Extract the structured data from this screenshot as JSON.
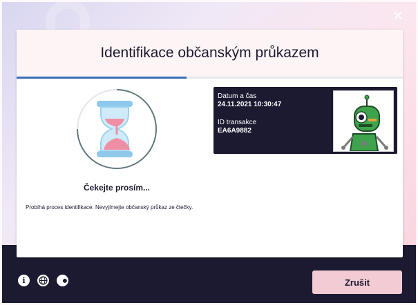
{
  "dialog": {
    "title": "Identifikace občanským průkazem",
    "progress_fraction": 0.44
  },
  "status": {
    "waiting_text": "Čekejte prosím...",
    "info_text": "Probíhá proces identifikace. Nevyjímejte občanský průkaz ze čtečky."
  },
  "transaction": {
    "datetime_label": "Datum a čas",
    "datetime_value": "24.11.2021 10:30:47",
    "id_label": "ID transakce",
    "id_value": "EA6A9882"
  },
  "footer": {
    "icons": [
      "info-icon",
      "globe-icon",
      "settings-wrench-icon"
    ],
    "cancel_label": "Zrušit"
  },
  "colors": {
    "dark_navy": "#1b1a30",
    "accent_pink": "#f3cbd4",
    "progress_blue": "#3a6db5",
    "robot_green": "#3fa34d"
  }
}
